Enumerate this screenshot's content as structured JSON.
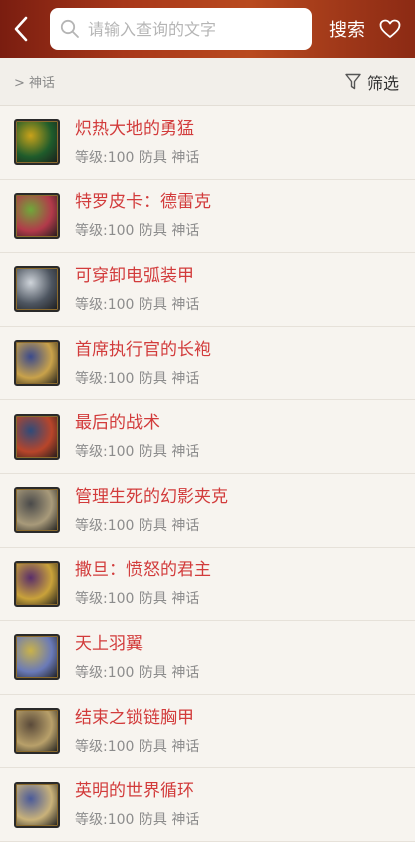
{
  "header": {
    "search_placeholder": "请输入查询的文字",
    "search_label": "搜索"
  },
  "filter_bar": {
    "breadcrumb": "> 神话",
    "filter_label": "筛选"
  },
  "items": [
    {
      "name": "炽热大地的勇猛",
      "meta": "等级:100 防具 神话",
      "thumb_colors": [
        "#c9a21a",
        "#1f5c2b"
      ]
    },
    {
      "name": "特罗皮卡：德雷克",
      "meta": "等级:100 防具 神话",
      "thumb_colors": [
        "#6fa83a",
        "#b23a4a"
      ]
    },
    {
      "name": "可穿卸电弧装甲",
      "meta": "等级:100 防具 神话",
      "thumb_colors": [
        "#cfd4da",
        "#4d5560"
      ]
    },
    {
      "name": "首席执行官的长袍",
      "meta": "等级:100 防具 神话",
      "thumb_colors": [
        "#3b4a8c",
        "#c9a24a"
      ]
    },
    {
      "name": "最后的战术",
      "meta": "等级:100 防具 神话",
      "thumb_colors": [
        "#2f4b7a",
        "#b8452a"
      ]
    },
    {
      "name": "管理生死的幻影夹克",
      "meta": "等级:100 防具 神话",
      "thumb_colors": [
        "#4a4a4a",
        "#a89a7a"
      ]
    },
    {
      "name": "撒旦：愤怒的君主",
      "meta": "等级:100 防具 神话",
      "thumb_colors": [
        "#5a2e6a",
        "#c9a23a"
      ]
    },
    {
      "name": "天上羽翼",
      "meta": "等级:100 防具 神话",
      "thumb_colors": [
        "#c9b24a",
        "#6a7ab8"
      ]
    },
    {
      "name": "结束之锁链胸甲",
      "meta": "等级:100 防具 神话",
      "thumb_colors": [
        "#5a4a3a",
        "#b8a06a"
      ]
    },
    {
      "name": "英明的世界循环",
      "meta": "等级:100 防具 神话",
      "thumb_colors": [
        "#4a5a9a",
        "#c9b27a"
      ]
    }
  ]
}
